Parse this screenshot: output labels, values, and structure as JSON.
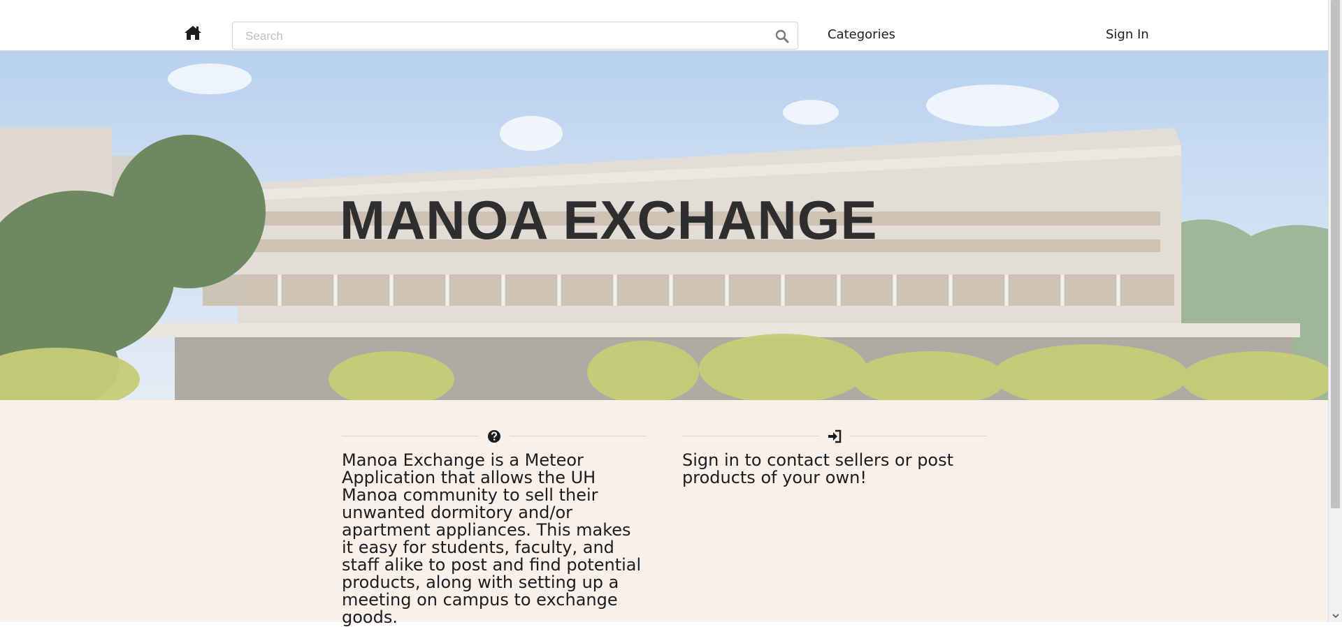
{
  "navbar": {
    "search_placeholder": "Search",
    "categories_label": "Categories",
    "signin_label": "Sign In",
    "icons": {
      "home": "home-icon",
      "search": "search-icon"
    }
  },
  "hero": {
    "title": "MANOA EXCHANGE",
    "background": "campus-building-photo"
  },
  "about": {
    "icon": "question-circle-icon",
    "text": "Manoa Exchange is a Meteor Application that allows the UH Manoa community to sell their unwanted dormitory and/or apartment appliances. This makes it easy for students, faculty, and staff alike to post and find potential products, along with setting up a meeting on campus to exchange goods."
  },
  "signin_info": {
    "icon": "sign-in-icon",
    "text": "Sign in to contact sellers or post products of your own!"
  },
  "colors": {
    "content_background": "#f9f0ea",
    "text": "#1b1c1d"
  }
}
